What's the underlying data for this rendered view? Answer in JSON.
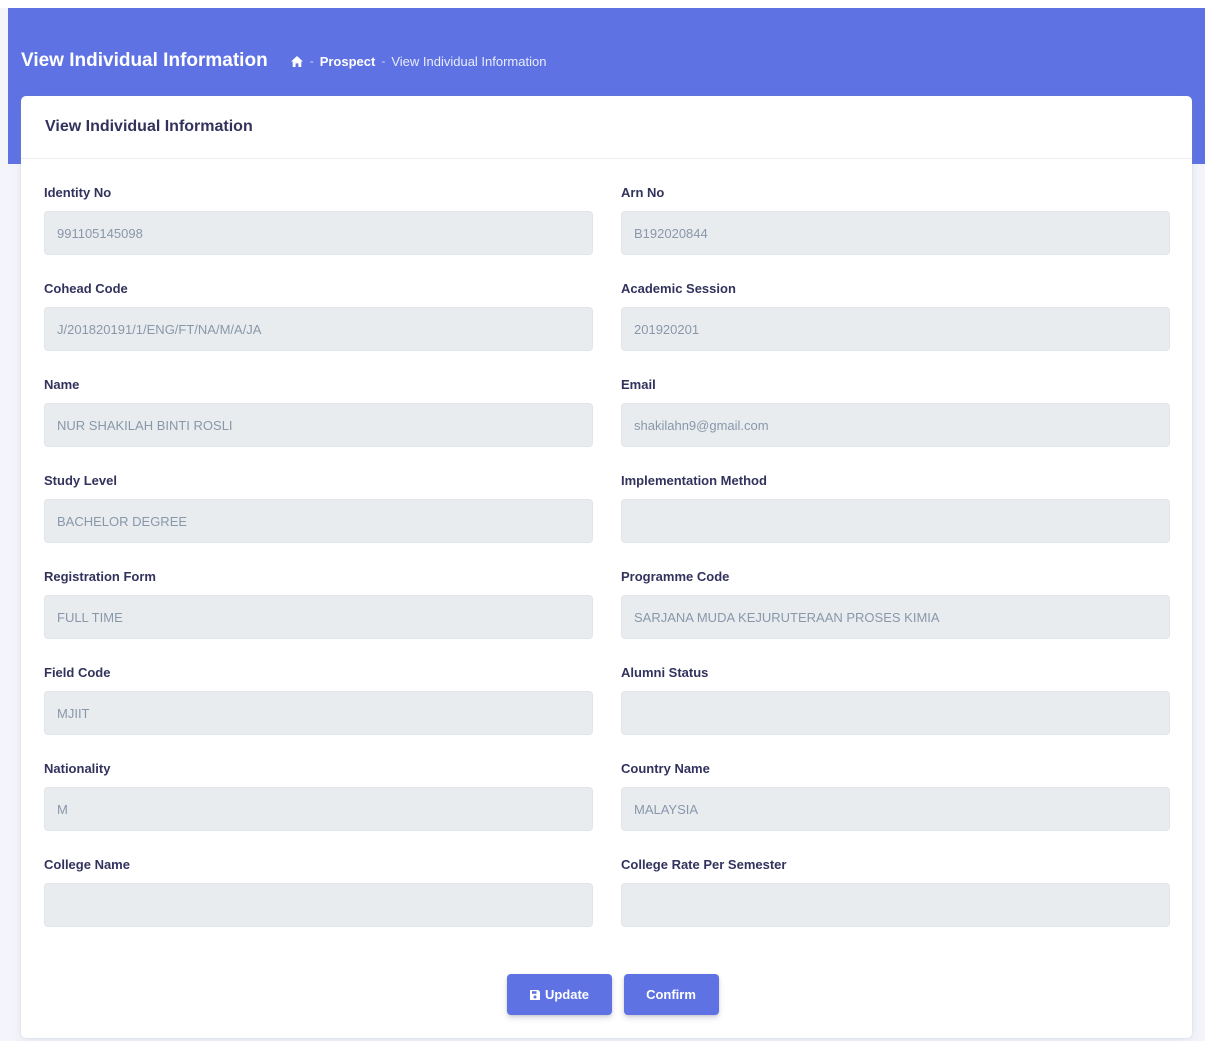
{
  "header": {
    "title": "View Individual Information",
    "breadcrumb": {
      "home_icon": "home-icon",
      "separator": "-",
      "items": [
        "Prospect",
        "View Individual Information"
      ]
    }
  },
  "card": {
    "title": "View Individual Information"
  },
  "fields": [
    {
      "label": "Identity No",
      "value": "991105145098"
    },
    {
      "label": "Arn No",
      "value": "B192020844"
    },
    {
      "label": "Cohead Code",
      "value": "J/201820191/1/ENG/FT/NA/M/A/JA"
    },
    {
      "label": "Academic Session",
      "value": "201920201"
    },
    {
      "label": "Name",
      "value": "NUR SHAKILAH BINTI ROSLI"
    },
    {
      "label": "Email",
      "value": "shakilahn9@gmail.com"
    },
    {
      "label": "Study Level",
      "value": "BACHELOR DEGREE"
    },
    {
      "label": "Implementation Method",
      "value": ""
    },
    {
      "label": "Registration Form",
      "value": "FULL TIME"
    },
    {
      "label": "Programme Code",
      "value": "SARJANA MUDA KEJURUTERAAN PROSES KIMIA"
    },
    {
      "label": "Field Code",
      "value": "MJIIT"
    },
    {
      "label": "Alumni Status",
      "value": ""
    },
    {
      "label": "Nationality",
      "value": "M"
    },
    {
      "label": "Country Name",
      "value": "MALAYSIA"
    },
    {
      "label": "College Name",
      "value": ""
    },
    {
      "label": "College Rate Per Semester",
      "value": ""
    }
  ],
  "actions": {
    "update_label": "Update",
    "update_icon": "save-icon",
    "confirm_label": "Confirm"
  },
  "colors": {
    "primary": "#5e72e4",
    "input_bg": "#e9ecef",
    "text_dark": "#32325d",
    "text_muted": "#8898aa"
  }
}
